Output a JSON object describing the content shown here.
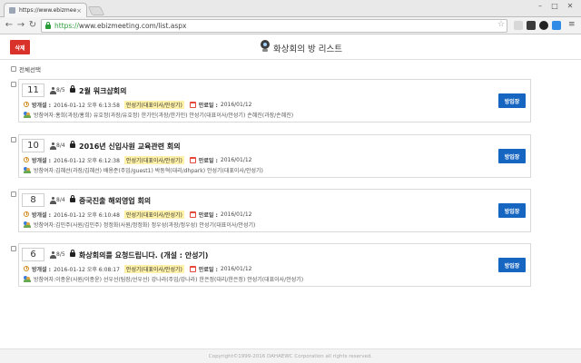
{
  "browser": {
    "tab_title": "https://www.ebizmeeting",
    "url_scheme": "https://",
    "url_rest": "www.ebizmeeting.com/list.aspx"
  },
  "header": {
    "delete_label": "삭제",
    "title": "화상회의 방 리스트"
  },
  "select_all_label": "전체선택",
  "rooms": [
    {
      "number": "11",
      "members": "8/5",
      "title": "2월 워크샵회의",
      "opened_label": "방개설 :",
      "opened": "2016-01-12 오후 6:13:58",
      "host": "안성기(대표이사/안성기)",
      "end_label": "만료일 :",
      "end": "2016/01/12",
      "participants_label": "방참여자:",
      "participants": "홍희(과장/홍희) 유호정(과장/유호정) 한가인(과장/한가인) 안성기(대표이사/안성기) 손혜진(과장/손혜진)",
      "enter_label": "방입장"
    },
    {
      "number": "10",
      "members": "8/4",
      "title": "2016년 신입사원 교육관련 회의",
      "opened_label": "방개설 :",
      "opened": "2016-01-12 오후 6:12:38",
      "host": "안성기(대표이사/안성기)",
      "end_label": "만료일 :",
      "end": "2016/01/12",
      "participants_label": "방참여자:",
      "participants": "김혜선(과장/김혜선) 배용준(주임/guest1) 박동혁(대리/dhpark) 안성기(대표이사/안성기)",
      "enter_label": "방입장"
    },
    {
      "number": "8",
      "members": "8/4",
      "title": "중국진출 해외영업 회의",
      "opened_label": "방개설 :",
      "opened": "2016-01-12 오후 6:10:48",
      "host": "안성기(대표이사/안성기)",
      "end_label": "만료일 :",
      "end": "2016/01/12",
      "participants_label": "방참여자:",
      "participants": "김민주(사원/김민주) 정정화(사원/정정화) 정우성(과장/정우성) 안성기(대표이사/안성기)",
      "enter_label": "방입장"
    },
    {
      "number": "6",
      "members": "8/5",
      "title": "화상회의를 요청드립니다. (개설 : 안성기)",
      "opened_label": "방개설 :",
      "opened": "2016-01-12 오후 6:08:17",
      "host": "안성기(대표이사/안성기)",
      "end_label": "만료일 :",
      "end": "2016/01/12",
      "participants_label": "방참여자:",
      "participants": "이종윤(사원/이종윤) 선우선(팀장/선우선) 강나라(주임/강나라) 한은정(대리/한은정) 안성기(대표이사/안성기)",
      "enter_label": "방입장"
    }
  ],
  "footer": "Copyright©1999-2016 DAHAEWC Corporation all rights reserved.",
  "colors": {
    "delete": "#d9322b",
    "enter": "#1665c0",
    "highlight": "#fff2a8"
  }
}
